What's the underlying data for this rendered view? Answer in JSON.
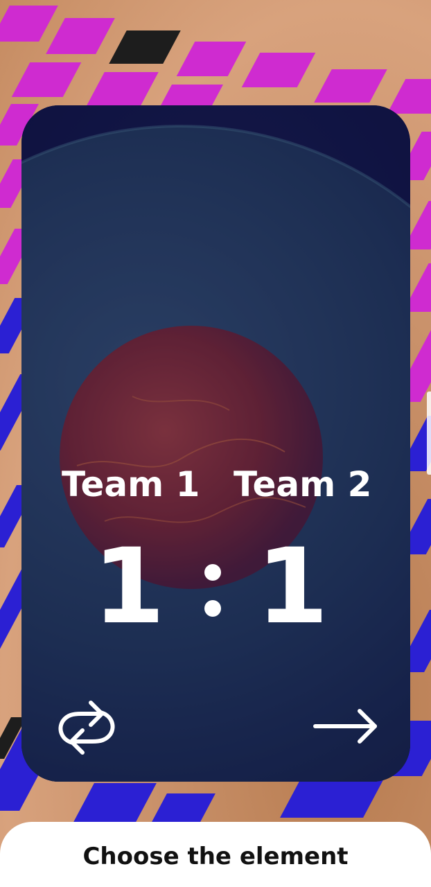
{
  "scoreboard": {
    "team1_name": "Team 1",
    "team2_name": "Team 2",
    "team1_score": "1",
    "team2_score": "1"
  },
  "controls": {
    "swap_icon": "swap-arrows-icon",
    "next_icon": "arrow-right-icon"
  },
  "bottom_sheet": {
    "title": "Choose the element"
  },
  "colors": {
    "card_background": "#161a4c",
    "text": "#ffffff",
    "tile_pink": "#cf2bd0",
    "tile_blue": "#2b20d3",
    "sheet_background": "#ffffff",
    "sheet_text": "#111111"
  }
}
